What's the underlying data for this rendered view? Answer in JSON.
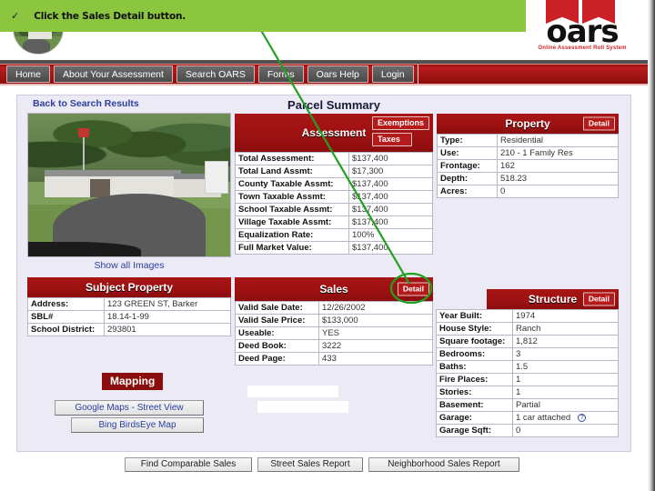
{
  "annotation": {
    "bullet": "✓",
    "text": "Click the Sales Detail button.",
    "banner_color": "#8cc63e",
    "highlight_color": "#22a022"
  },
  "logo": {
    "wordmark": "oars",
    "tagline": "Online Assessment Roll System",
    "brand_color": "#cc2027"
  },
  "nav": {
    "items": [
      {
        "label": "Home"
      },
      {
        "label": "About Your Assessment"
      },
      {
        "label": "Search OARS"
      },
      {
        "label": "Forms"
      },
      {
        "label": "Oars Help"
      },
      {
        "label": "Login"
      }
    ]
  },
  "links": {
    "back_to_search": "Back to Search Results",
    "show_all_images": "Show all Images"
  },
  "page_title": "Parcel Summary",
  "assessment": {
    "heading": "Assessment",
    "buttons": {
      "exemptions": "Exemptions",
      "taxes": "Taxes"
    },
    "rows": [
      {
        "label": "Total Assessment:",
        "value": "$137,400"
      },
      {
        "label": "Total Land Assmt:",
        "value": "$17,300"
      },
      {
        "label": "County Taxable Assmt:",
        "value": "$137,400"
      },
      {
        "label": "Town Taxable Assmt:",
        "value": "$137,400"
      },
      {
        "label": "School Taxable Assmt:",
        "value": "$137,400"
      },
      {
        "label": "Village Taxable Assmt:",
        "value": "$137,400"
      },
      {
        "label": "Equalization Rate:",
        "value": "100%"
      },
      {
        "label": "Full Market Value:",
        "value": "$137,400"
      }
    ]
  },
  "property": {
    "heading": "Property",
    "detail_label": "Detail",
    "rows": [
      {
        "label": "Type:",
        "value": "Residential"
      },
      {
        "label": "Use:",
        "value": "210 - 1 Family Res"
      },
      {
        "label": "Frontage:",
        "value": "162"
      },
      {
        "label": "Depth:",
        "value": "518.23"
      },
      {
        "label": "Acres:",
        "value": "0"
      }
    ]
  },
  "subject_property": {
    "heading": "Subject Property",
    "rows": [
      {
        "label": "Address:",
        "value": "123 GREEN ST, Barker"
      },
      {
        "label": "SBL#",
        "value": "18.14-1-99"
      },
      {
        "label": "School District:",
        "value": "293801"
      }
    ]
  },
  "sales": {
    "heading": "Sales",
    "detail_label": "Detail",
    "rows": [
      {
        "label": "Valid Sale Date:",
        "value": "12/26/2002"
      },
      {
        "label": "Valid Sale Price:",
        "value": "$133,000"
      },
      {
        "label": "Useable:",
        "value": "YES"
      },
      {
        "label": "Deed Book:",
        "value": "3222"
      },
      {
        "label": "Deed Page:",
        "value": "433"
      }
    ]
  },
  "structure": {
    "heading": "Structure",
    "detail_label": "Detail",
    "help_icon": "?",
    "rows": [
      {
        "label": "Year Built:",
        "value": "1974"
      },
      {
        "label": "House Style:",
        "value": "Ranch"
      },
      {
        "label": "Square footage:",
        "value": "1,812"
      },
      {
        "label": "Bedrooms:",
        "value": "3"
      },
      {
        "label": "Baths:",
        "value": "1.5"
      },
      {
        "label": "Fire Places:",
        "value": "1"
      },
      {
        "label": "Stories:",
        "value": "1"
      },
      {
        "label": "Basement:",
        "value": "Partial"
      },
      {
        "label": "Garage:",
        "value": "1 car attached"
      },
      {
        "label": "Garage Sqft:",
        "value": "0"
      }
    ]
  },
  "mapping": {
    "heading": "Mapping",
    "buttons": [
      {
        "label": "Google Maps - Street View"
      },
      {
        "label": "Bing BirdsEye Map"
      }
    ]
  },
  "reports": {
    "buttons": [
      {
        "label": "Find Comparable Sales"
      },
      {
        "label": "Street Sales Report"
      },
      {
        "label": "Neighborhood Sales Report"
      }
    ]
  }
}
